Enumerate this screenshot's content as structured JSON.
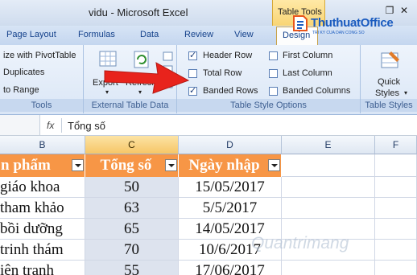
{
  "window": {
    "title": "vidu - Microsoft Excel",
    "context_tab": "Table Tools"
  },
  "logo": {
    "name": "ThuthuatOffice",
    "tagline": "TRI KY CUA DAN CONG SO"
  },
  "tabs": [
    "Page Layout",
    "Formulas",
    "Data",
    "Review",
    "View",
    "Design"
  ],
  "ribbon": {
    "tools": {
      "items": [
        "ize with PivotTable",
        "Duplicates",
        "to Range"
      ],
      "label": "Tools"
    },
    "external": {
      "export": "Export",
      "refresh": "Refresh",
      "label": "External Table Data"
    },
    "style_options": {
      "label": "Table Style Options",
      "options": [
        {
          "label": "Header Row",
          "checked": true
        },
        {
          "label": "Total Row",
          "checked": false
        },
        {
          "label": "Banded Rows",
          "checked": true
        },
        {
          "label": "First Column",
          "checked": false
        },
        {
          "label": "Last Column",
          "checked": false
        },
        {
          "label": "Banded Columns",
          "checked": false
        }
      ]
    },
    "styles": {
      "quick": "Quick",
      "styles": "Styles",
      "label": "Table Styles"
    }
  },
  "formula_bar": {
    "fx": "fx",
    "content": "Tổng số"
  },
  "columns": [
    "B",
    "C",
    "D",
    "E",
    "F"
  ],
  "table": {
    "headers": [
      "n phẩm",
      "Tổng số",
      "Ngày nhập"
    ],
    "rows": [
      [
        "giáo khoa",
        "50",
        "15/05/2017"
      ],
      [
        "tham khảo",
        "63",
        "5/5/2017"
      ],
      [
        "bồi dưỡng",
        "65",
        "14/05/2017"
      ],
      [
        " trinh thám",
        "70",
        "10/6/2017"
      ],
      [
        "iện tranh",
        "55",
        "17/06/2017"
      ]
    ]
  },
  "watermark": "Quantrimang",
  "colors": {
    "header_fill": "#f79646",
    "selected_column": "#dde3ee",
    "arrow": "#e8231c"
  }
}
